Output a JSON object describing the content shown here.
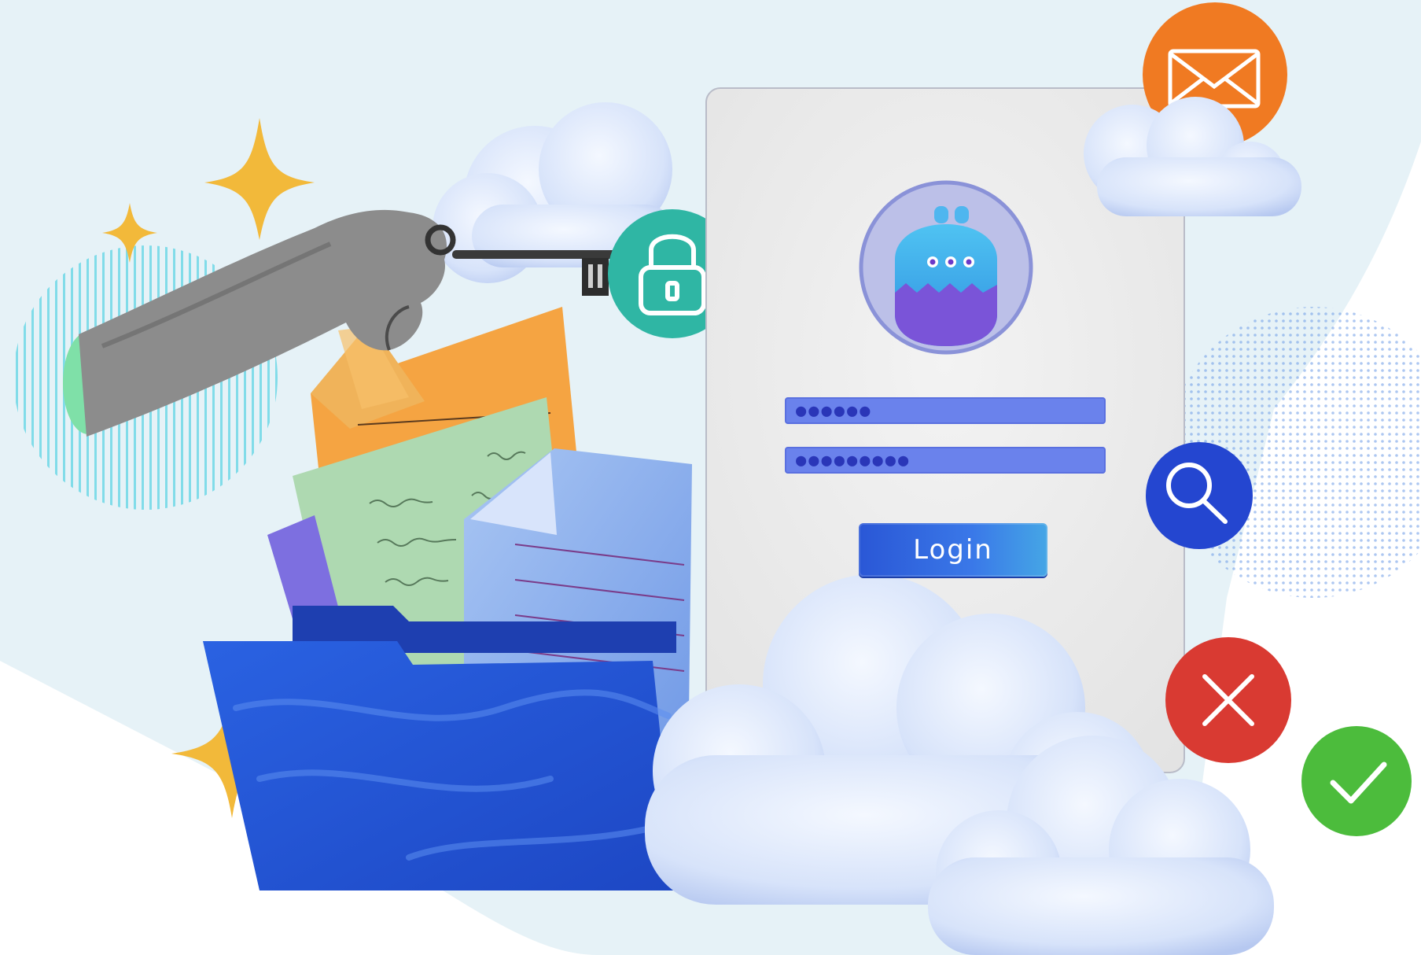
{
  "login_form": {
    "button_label": "Login",
    "password_1": "●●●●●●",
    "password_2": "●●●●●●●●●"
  },
  "icons": {
    "mail": "mail-icon",
    "lock": "lock-icon",
    "search": "search-icon",
    "close": "close-icon",
    "check": "check-icon",
    "avatar": "monster-avatar-icon",
    "key": "key-icon",
    "folder": "folder-icon",
    "sparkle": "sparkle-icon",
    "cloud": "cloud-icon"
  },
  "colors": {
    "background_shape": "#e6f2f7",
    "mail_badge": "#f07a22",
    "lock_badge": "#2fb6a4",
    "search_badge": "#2446d0",
    "close_badge": "#d93a32",
    "check_badge": "#4cbc3c",
    "folder": "#1f55d8",
    "login_button": "#2a57d6",
    "field": "#6a82ec",
    "sparkle": "#f2b93a"
  }
}
